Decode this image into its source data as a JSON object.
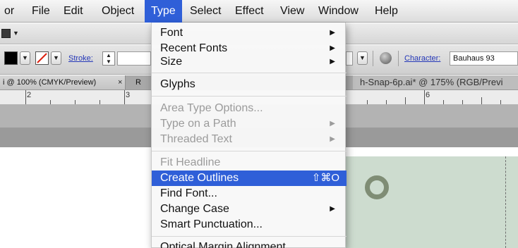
{
  "menubar": {
    "items": [
      "or",
      "File",
      "Edit",
      "Object",
      "Type",
      "Select",
      "Effect",
      "View",
      "Window",
      "Help"
    ],
    "active_item": "Type"
  },
  "control_bar": {
    "stroke_label": "Stroke:",
    "character_label": "Character:",
    "character_font": "Bauhaus 93"
  },
  "tabs": {
    "tab1_label": "i @ 100% (CMYK/Preview)",
    "tab1_close": "×",
    "tab1b_label": "R",
    "tab2_label": "h-Snap-6p.ai* @ 175% (RGB/Previ"
  },
  "ruler": {
    "marks": [
      "2",
      "3",
      "6"
    ]
  },
  "type_menu": {
    "items": [
      {
        "label": "Font",
        "submenu": true,
        "enabled": true
      },
      {
        "label": "Recent Fonts",
        "submenu": true,
        "enabled": true
      },
      {
        "label": "Size",
        "submenu": true,
        "enabled": true
      },
      {
        "label": "Glyphs",
        "submenu": false,
        "enabled": true
      },
      {
        "label": "Area Type Options...",
        "submenu": false,
        "enabled": false
      },
      {
        "label": "Type on a Path",
        "submenu": true,
        "enabled": false
      },
      {
        "label": "Threaded Text",
        "submenu": true,
        "enabled": false
      },
      {
        "label": "Fit Headline",
        "submenu": false,
        "enabled": false
      },
      {
        "label": "Create Outlines",
        "submenu": false,
        "enabled": true,
        "highlighted": true,
        "shortcut": "⇧⌘O"
      },
      {
        "label": "Find Font...",
        "submenu": false,
        "enabled": true
      },
      {
        "label": "Change Case",
        "submenu": true,
        "enabled": true
      },
      {
        "label": "Smart Punctuation...",
        "submenu": false,
        "enabled": true
      },
      {
        "label": "Optical Margin Alignment",
        "submenu": false,
        "enabled": true
      }
    ],
    "submenu_arrow": "▶"
  },
  "colors": {
    "menu_highlight": "#2f5fd8",
    "artboard_fill": "#cddccf",
    "ring_color": "#7f8d75",
    "link_blue": "#2437b8"
  },
  "icons": [
    "globe-icon",
    "stroke-stepper-icon",
    "none-fill-icon",
    "dropdown-arrow-icon",
    "submenu-arrow-icon"
  ]
}
